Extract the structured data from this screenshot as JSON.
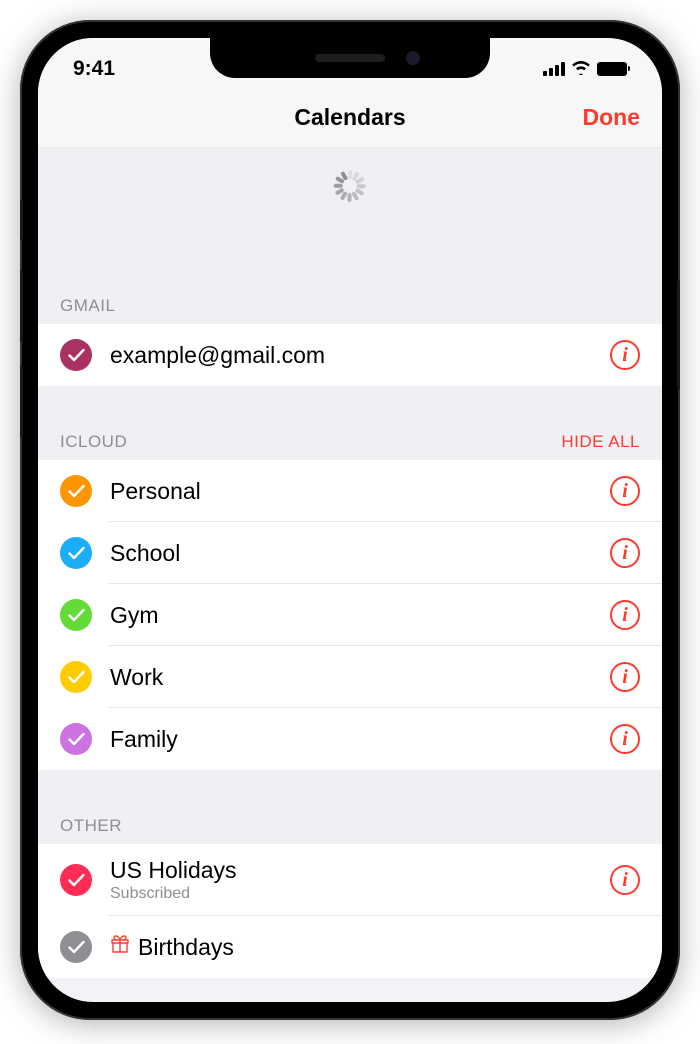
{
  "status": {
    "time": "9:41"
  },
  "nav": {
    "title": "Calendars",
    "done": "Done"
  },
  "sections": {
    "gmail": {
      "label": "GMAIL",
      "items": [
        {
          "label": "example@gmail.com",
          "color": "#a93263",
          "info": true
        }
      ]
    },
    "icloud": {
      "label": "ICLOUD",
      "action": "HIDE ALL",
      "items": [
        {
          "label": "Personal",
          "color": "#ff9500",
          "info": true
        },
        {
          "label": "School",
          "color": "#1badf8",
          "info": true
        },
        {
          "label": "Gym",
          "color": "#63da38",
          "info": true
        },
        {
          "label": "Work",
          "color": "#ffcc00",
          "info": true
        },
        {
          "label": "Family",
          "color": "#cc73e1",
          "info": true
        }
      ]
    },
    "other": {
      "label": "OTHER",
      "items": [
        {
          "label": "US Holidays",
          "sublabel": "Subscribed",
          "color": "#ff2d55",
          "info": true
        },
        {
          "label": "Birthdays",
          "color": "#8e8e93",
          "icon": "gift",
          "info": false
        }
      ]
    }
  }
}
